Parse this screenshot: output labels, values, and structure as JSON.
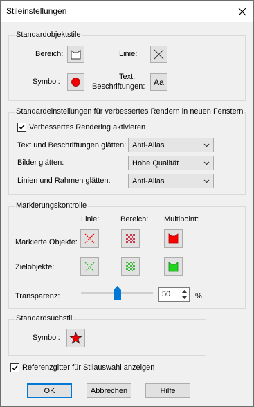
{
  "window": {
    "title": "Stileinstellungen",
    "close_glyph": "✕"
  },
  "standard_styles": {
    "group_label": "Standardobjektstile",
    "area_label": "Bereich:",
    "line_label": "Linie:",
    "symbol_label": "Symbol:",
    "text_label_line1": "Text:",
    "text_label_line2": "Beschriftungen:",
    "text_button": "Aa",
    "icons": {
      "area": "area-polygon-icon",
      "line": "cross-line-icon",
      "symbol": "red-circle-icon"
    }
  },
  "rendering": {
    "group_label": "Standardeinstellungen für verbessertes Rendern in neuen Fenstern",
    "enable_label": "Verbessertes Rendering aktivieren",
    "enable_checked": true,
    "rows": [
      {
        "label": "Text und Beschriftungen glätten:",
        "value": "Anti-Alias"
      },
      {
        "label": "Bilder glätten:",
        "value": "Hohe Qualität"
      },
      {
        "label": "Linien und Rahmen glätten:",
        "value": "Anti-Alias"
      }
    ]
  },
  "highlight": {
    "group_label": "Markierungskontrolle",
    "col_line": "Linie:",
    "col_area": "Bereich:",
    "col_multipoint": "Multipoint:",
    "row_selected": "Markierte Objekte:",
    "row_target": "Zielobjekte:",
    "transparency_label": "Transparenz:",
    "transparency_value": "50",
    "transparency_unit": "%",
    "transparency_fraction": 0.5,
    "colors": {
      "selected": "#ff0000",
      "target": "#22c422"
    }
  },
  "search_style": {
    "group_label": "Standardsuchstil",
    "symbol_label": "Symbol:",
    "icon": "red-star-icon"
  },
  "reference_grid": {
    "label": "Referenzgitter für Stilauswahl anzeigen",
    "checked": true
  },
  "buttons": {
    "ok": "OK",
    "cancel": "Abbrechen",
    "help": "Hilfe"
  }
}
